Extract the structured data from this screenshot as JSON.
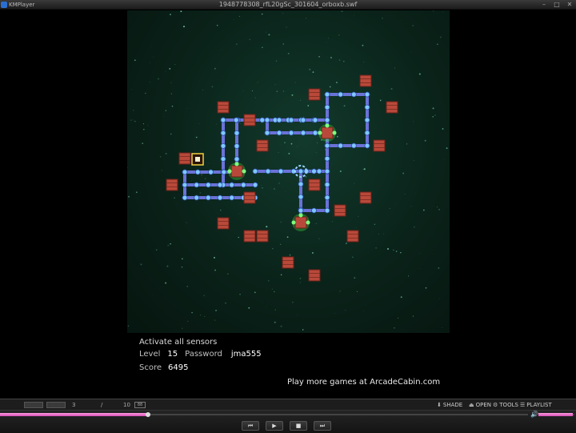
{
  "window": {
    "app_name": "KMPlayer",
    "file_title": "1948778308_rfL20gSc_301604_orboxb.swf",
    "buttons": [
      "–",
      "□",
      "✕"
    ]
  },
  "game": {
    "objective": "Activate all sensors",
    "level_label": "Level",
    "level_value": "15",
    "password_label": "Password",
    "password_value": "jma555",
    "score_label": "Score",
    "score_value": "6495",
    "promo": "Play more games at ArcadeCabin.com",
    "colors": {
      "brick": "#b8493a",
      "track": "#6a72d8",
      "node": "#7fc7ff",
      "sensor": "#40e040",
      "background": "#0a2219"
    }
  },
  "player": {
    "frame_current": "3",
    "frame_separator": "/",
    "frame_total": "10",
    "frame_unit": "88",
    "menu": {
      "shade": "SHADE",
      "open": "OPEN",
      "tools": "TOOLS",
      "playlist": "PLAYLIST"
    },
    "seek_fraction": 0.28,
    "volume_fraction": 0.95,
    "transport": {
      "prev": "⏮",
      "play": "▶",
      "stop": "■",
      "next": "⏭"
    }
  }
}
